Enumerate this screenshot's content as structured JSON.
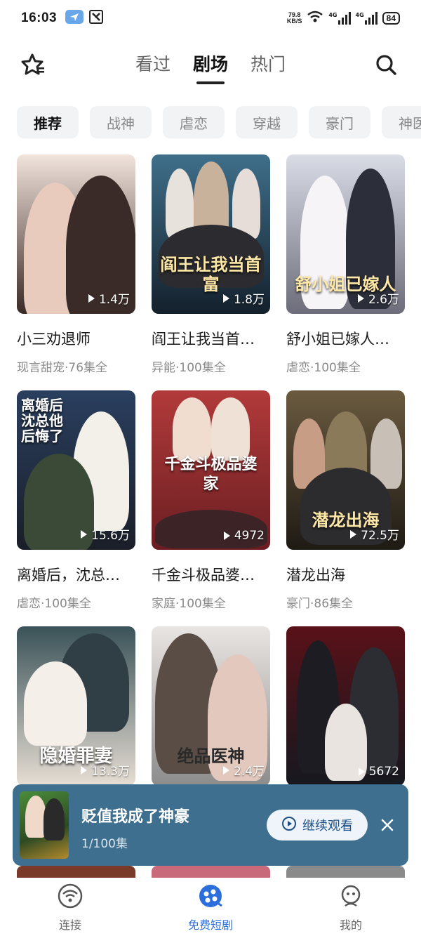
{
  "status": {
    "time": "16:03",
    "net_speed_value": "79.8",
    "net_speed_unit": "KB/S",
    "signal1": "4G",
    "signal2": "4G",
    "battery": "84"
  },
  "header": {
    "tabs": [
      {
        "label": "看过",
        "active": false
      },
      {
        "label": "剧场",
        "active": true
      },
      {
        "label": "热门",
        "active": false
      }
    ]
  },
  "categories": [
    {
      "label": "推荐",
      "active": true
    },
    {
      "label": "战神",
      "active": false
    },
    {
      "label": "虐恋",
      "active": false
    },
    {
      "label": "穿越",
      "active": false
    },
    {
      "label": "豪门",
      "active": false
    },
    {
      "label": "神医",
      "active": false
    }
  ],
  "dramas": [
    {
      "title": "小三劝退师",
      "meta": "现言甜宠·76集全",
      "plays": "1.4万",
      "poster_text": "",
      "colors": [
        "#f1e4dc",
        "#3a2a26"
      ]
    },
    {
      "title": "阎王让我当首…",
      "meta": "异能·100集全",
      "plays": "1.8万",
      "poster_text": "阎王让我当首富",
      "colors": [
        "#3f6f8a",
        "#14202c"
      ]
    },
    {
      "title": "舒小姐已嫁人…",
      "meta": "虐恋·100集全",
      "plays": "2.6万",
      "poster_text": "舒小姐已嫁人",
      "colors": [
        "#d9dde6",
        "#6d6c7a"
      ]
    },
    {
      "title": "离婚后，沈总…",
      "meta": "虐恋·100集全",
      "plays": "15.6万",
      "poster_text": "离婚后沈总他后悔了",
      "colors": [
        "#2a3f5f",
        "#1a1e28"
      ]
    },
    {
      "title": "千金斗极品婆…",
      "meta": "家庭·100集全",
      "plays": "4972",
      "poster_text": "千金斗极品婆家",
      "colors": [
        "#b23a3a",
        "#6a1e22"
      ]
    },
    {
      "title": "潜龙出海",
      "meta": "豪门·86集全",
      "plays": "72.5万",
      "poster_text": "潜龙出海",
      "colors": [
        "#6a5a3f",
        "#1e1a14"
      ]
    },
    {
      "title": "",
      "meta": "",
      "plays": "13.3万",
      "poster_text": "隐婚罪妻",
      "colors": [
        "#3a5258",
        "#e7ded4"
      ]
    },
    {
      "title": "",
      "meta": "",
      "plays": "2.4万",
      "poster_text": "绝品医神",
      "colors": [
        "#e9e5e2",
        "#8c8c8c"
      ]
    },
    {
      "title": "",
      "meta": "",
      "plays": "5672",
      "poster_text": "",
      "colors": [
        "#5a1118",
        "#16181f"
      ]
    }
  ],
  "mini_player": {
    "title": "贬值我成了神豪",
    "progress": "1/100集",
    "continue_label": "继续观看"
  },
  "bottom_nav": [
    {
      "label": "连接",
      "icon": "wifi-icon",
      "active": false
    },
    {
      "label": "免费短剧",
      "icon": "drama-icon",
      "active": true
    },
    {
      "label": "我的",
      "icon": "profile-icon",
      "active": false
    }
  ]
}
